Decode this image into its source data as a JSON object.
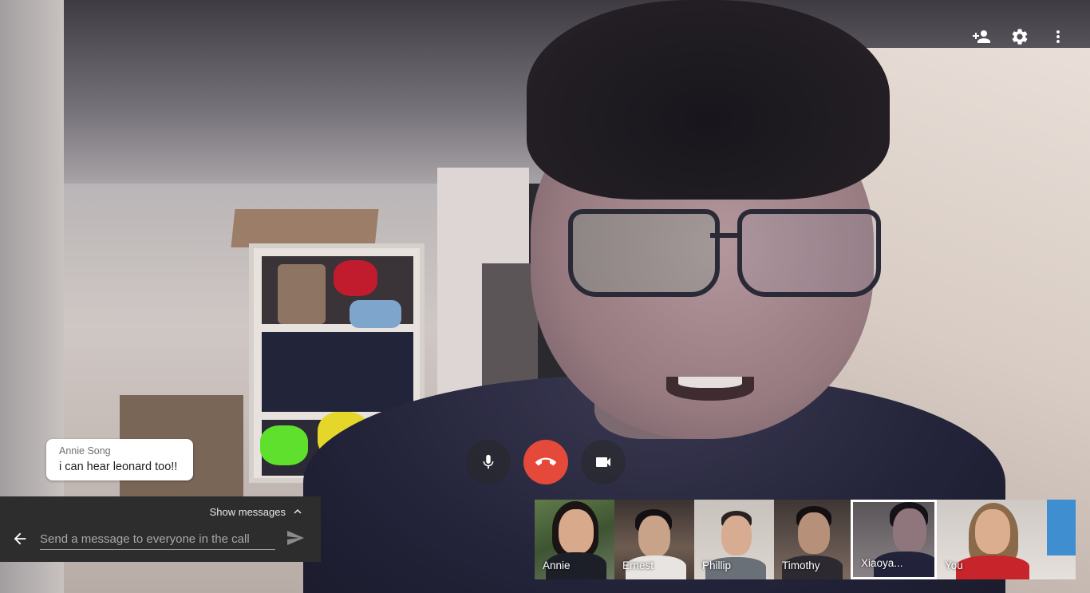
{
  "top_controls": {
    "add_person_icon": "person-add-icon",
    "settings_icon": "gear-icon",
    "more_icon": "more-vert-icon"
  },
  "chat_bubble": {
    "sender": "Annie Song",
    "message": "i can hear leonard too!!"
  },
  "message_panel": {
    "show_messages_label": "Show messages",
    "input_value": "",
    "input_placeholder": "Send a message to everyone in the call"
  },
  "call_controls": {
    "mic_icon": "microphone-icon",
    "hangup_icon": "hangup-icon",
    "camera_icon": "camera-icon",
    "hangup_color": "#e5493a"
  },
  "participants": [
    {
      "name": "Annie"
    },
    {
      "name": "Ernest"
    },
    {
      "name": "Phillip"
    },
    {
      "name": "Timothy"
    },
    {
      "name": "Xiaoya..."
    },
    {
      "name": "You"
    }
  ]
}
